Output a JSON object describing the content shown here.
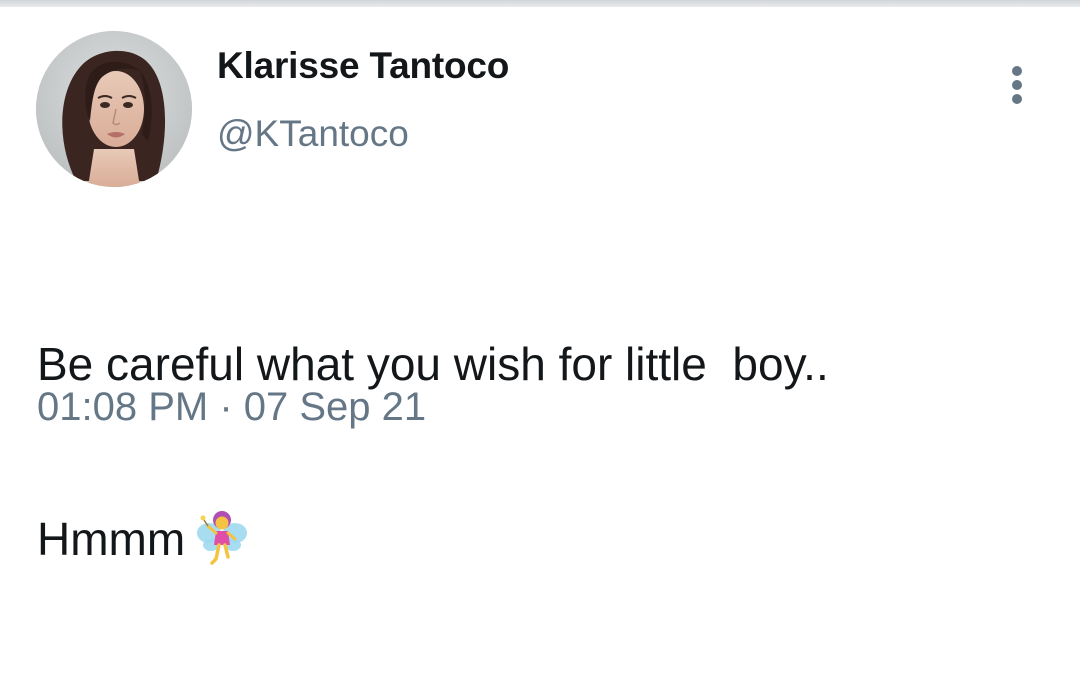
{
  "user": {
    "display_name": "Klarisse Tantoco",
    "handle": "@KTantoco",
    "avatar_icon": "profile-photo"
  },
  "tweet": {
    "line1": "Be careful what you wish for little  boy..",
    "line2": "Hmmm",
    "emoji_icon": "fairy-emoji",
    "timestamp_partial": "01:08 PM · 07 Sep 21"
  },
  "menu": {
    "icon": "more-vertical-icon"
  },
  "colors": {
    "text": "#14171a",
    "secondary": "#657786",
    "background": "#ffffff"
  }
}
